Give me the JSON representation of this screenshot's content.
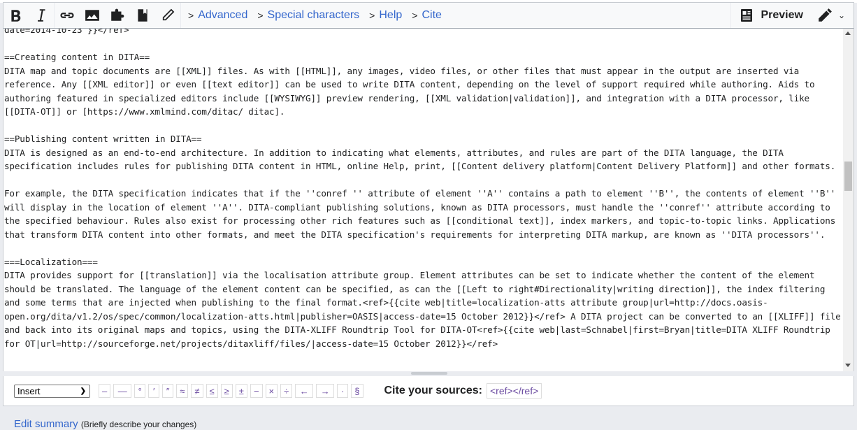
{
  "toolbar": {
    "buttons": [
      {
        "name": "bold",
        "icon": "bold-icon"
      },
      {
        "name": "italic",
        "icon": "italic-icon"
      },
      {
        "name": "link",
        "icon": "link-icon"
      },
      {
        "name": "image",
        "icon": "image-icon"
      },
      {
        "name": "template",
        "icon": "puzzle-icon"
      },
      {
        "name": "reference",
        "icon": "bookmark-icon"
      },
      {
        "name": "highlight",
        "icon": "pencil-icon"
      }
    ],
    "tabs": [
      {
        "label": "Advanced"
      },
      {
        "label": "Special characters"
      },
      {
        "label": "Help"
      },
      {
        "label": "Cite"
      }
    ],
    "preview_label": "Preview",
    "mode_icon": "pencil-icon"
  },
  "editor": {
    "lines": [
      "date=2014-10-23 }}</ref>",
      "",
      "==Creating content in DITA==",
      "DITA map and topic documents are [[XML]] files. As with [[HTML]], any images, video files, or other files that must appear in the output are inserted via reference. Any [[XML editor]] or even [[text editor]] can be used to write DITA content, depending on the level of support required while authoring. Aids to authoring featured in specialized editors include [[WYSIWYG]] preview rendering, [[XML validation|validation]], and integration with a DITA processor, like [[DITA-OT]] or [https://www.xmlmind.com/ditac/ ditac].",
      "",
      "==Publishing content written in DITA==",
      "DITA is designed as an end-to-end architecture. In addition to indicating what elements, attributes, and rules are part of the DITA language, the DITA specification includes rules for publishing DITA content in HTML, online Help, print, [[Content delivery platform|Content Delivery Platform]] and other formats.",
      "",
      "For example, the DITA specification indicates that if the ''conref '' attribute of element ''A'' contains a path to element ''B'', the contents of element ''B'' will display in the location of element ''A''. DITA-compliant publishing solutions, known as DITA processors, must handle the ''conref'' attribute according to the specified behaviour. Rules also exist for processing other rich features such as [[conditional text]], index markers, and topic-to-topic links. Applications that transform DITA content into other formats, and meet the DITA specification's requirements for interpreting DITA markup, are known as ''DITA processors''.",
      "",
      "===Localization===",
      "DITA provides support for [[translation]] via the localisation attribute group. Element attributes can be set to indicate whether the content of the element should be translated. The language of the element content can be specified, as can the [[Left to right#Directionality|writing direction]], the index filtering and some terms that are injected when publishing to the final format.<ref>{{cite web|title=localization-atts attribute group|url=http://docs.oasis-open.org/dita/v1.2/os/spec/common/localization-atts.html|publisher=OASIS|access-date=15 October 2012}}</ref> A DITA project can be converted to an [[XLIFF]] file and back into its original maps and topics, using the DITA-XLIFF Roundtrip Tool for DITA-OT<ref>{{cite web|last=Schnabel|first=Bryan|title=DITA XLIFF Roundtrip for OT|url=http://sourceforge.net/projects/ditaxliff/files/|access-date=15 October 2012}}</ref>"
    ]
  },
  "special_chars": {
    "insert_select": "Insert",
    "chars": [
      "–",
      "—",
      "°",
      "′",
      "″",
      "≈",
      "≠",
      "≤",
      "≥",
      "±",
      "−",
      "×",
      "÷",
      "←",
      "→",
      "·",
      "§"
    ],
    "cite_label": "Cite your sources:",
    "ref_button": "<ref></ref>"
  },
  "summary": {
    "link": "Edit summary",
    "hint": "(Briefly describe your changes)"
  },
  "colors": {
    "link": "#3366cc",
    "special_char": "#6b4ba1",
    "toolbar_bg": "#f8f9fa",
    "page_bg": "#eaecf0"
  }
}
